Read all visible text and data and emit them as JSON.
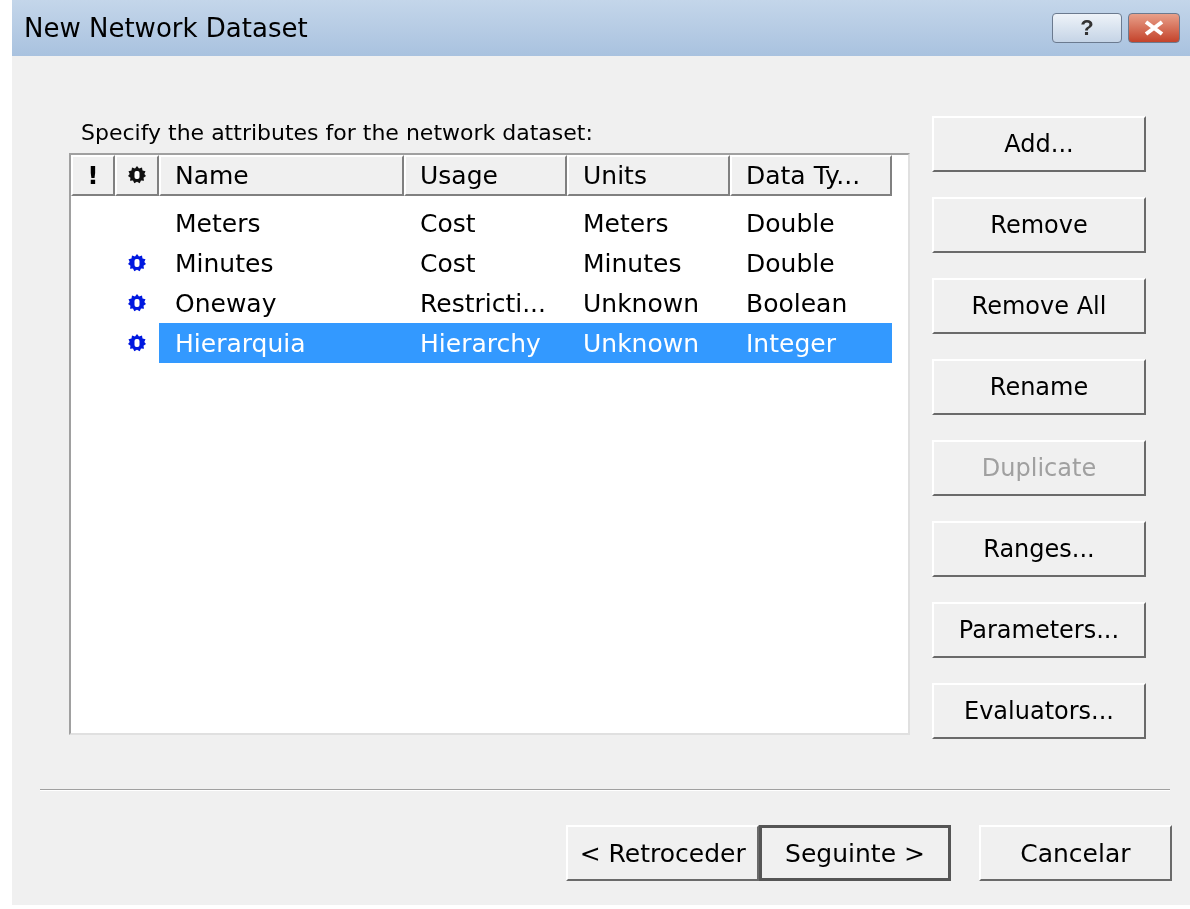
{
  "window": {
    "title": "New Network Dataset",
    "help_label": "?"
  },
  "prompt": "Specify the attributes for the network dataset:",
  "table": {
    "columns": [
      "!",
      "",
      "Name",
      "Usage",
      "Units",
      "Data Ty..."
    ],
    "rows": [
      {
        "has_marker": false,
        "selected": false,
        "cells": [
          "",
          "",
          "Meters",
          "Cost",
          "Meters",
          "Double"
        ]
      },
      {
        "has_marker": true,
        "selected": false,
        "cells": [
          "",
          "",
          "Minutes",
          "Cost",
          "Minutes",
          "Double"
        ]
      },
      {
        "has_marker": true,
        "selected": false,
        "cells": [
          "",
          "",
          "Oneway",
          "Restricti...",
          "Unknown",
          "Boolean"
        ]
      },
      {
        "has_marker": true,
        "selected": true,
        "cells": [
          "",
          "",
          "Hierarquia",
          "Hierarchy",
          "Unknown",
          "Integer"
        ]
      }
    ]
  },
  "side_buttons": [
    {
      "label": "Add...",
      "disabled": false
    },
    {
      "label": "Remove",
      "disabled": false
    },
    {
      "label": "Remove All",
      "disabled": false
    },
    {
      "label": "Rename",
      "disabled": false
    },
    {
      "label": "Duplicate",
      "disabled": true
    },
    {
      "label": "Ranges...",
      "disabled": false
    },
    {
      "label": "Parameters...",
      "disabled": false
    },
    {
      "label": "Evaluators...",
      "disabled": false
    }
  ],
  "footer_buttons": [
    {
      "label": "< Retroceder",
      "default": false
    },
    {
      "label": "Seguinte >",
      "default": true
    },
    {
      "label": "Cancelar",
      "default": false
    }
  ]
}
